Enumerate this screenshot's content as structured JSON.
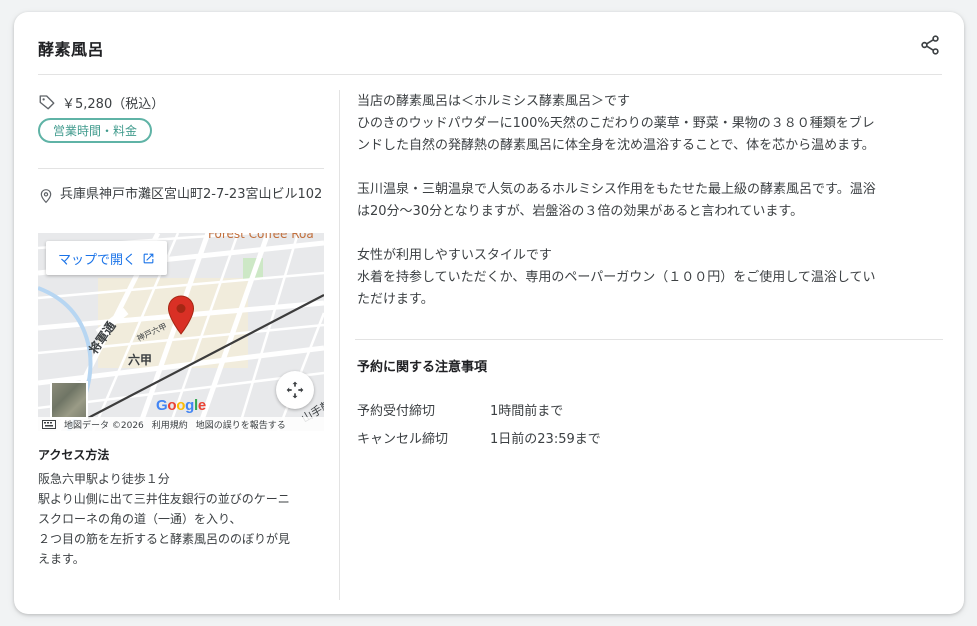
{
  "header": {
    "title": "酵素風呂"
  },
  "price": {
    "text": "￥5,280（税込）"
  },
  "hours_button": {
    "label": "営業時間・料金"
  },
  "address": {
    "text": "兵庫県神戸市灘区宮山町2-7-23宮山ビル102"
  },
  "map": {
    "open_label": "マップで開く",
    "labels": {
      "cafe": "Forest Coffee Roa",
      "station": "六甲",
      "road": "将軍通",
      "road2": "山手幹",
      "shrine": "神戸六甲"
    },
    "google": "Google",
    "attribution": {
      "data": "地図データ ©2026",
      "terms": "利用規約",
      "report": "地図の誤りを報告する"
    }
  },
  "access": {
    "title": "アクセス方法",
    "lines": [
      "阪急六甲駅より徒歩１分",
      "駅より山側に出て三井住友銀行の並びのケーニ",
      "スクローネの角の道（一通）を入り、",
      "２つ目の筋を左折すると酵素風呂ののぼりが見",
      "えます。"
    ]
  },
  "description": {
    "paragraphs": [
      [
        "当店の酵素風呂は＜ホルミシス酵素風呂＞です",
        "ひのきのウッドパウダーに100%天然のこだわりの薬草・野菜・果物の３８０種類をブレ",
        "ンドした自然の発酵熱の酵素風呂に体全身を沈め温浴することで、体を芯から温めます。"
      ],
      [
        "玉川温泉・三朝温泉で人気のあるホルミシス作用をもたせた最上級の酵素風呂です。温浴",
        "は20分〜30分となりますが、岩盤浴の３倍の効果があると言われています。"
      ],
      [
        "女性が利用しやすいスタイルです",
        "水着を持参していただくか、専用のペーパーガウン（１００円）をご使用して温浴してい",
        "ただけます。"
      ]
    ]
  },
  "notice": {
    "title": "予約に関する注意事項",
    "rows": [
      {
        "key": "予約受付締切",
        "value": "1時間前まで"
      },
      {
        "key": "キャンセル締切",
        "value": "1日前の23:59まで"
      }
    ]
  },
  "colors": {
    "accent_teal": "#5fb3a6",
    "link_blue": "#1a73e8",
    "pin_red": "#d93025"
  }
}
